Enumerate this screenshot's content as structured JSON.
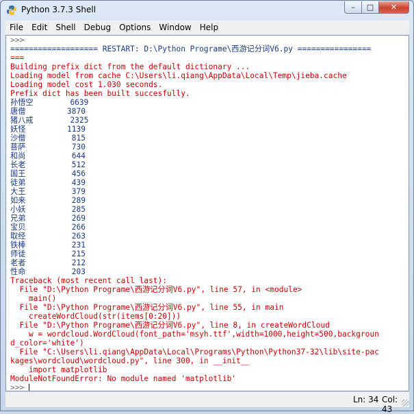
{
  "window": {
    "title": "Python 3.7.3 Shell",
    "buttons": {
      "minimize": "–",
      "maximize": "□",
      "close": "✕"
    }
  },
  "menu": [
    "File",
    "Edit",
    "Shell",
    "Debug",
    "Options",
    "Window",
    "Help"
  ],
  "shell_lines": [
    {
      "text": ">>>",
      "style": "prompt"
    },
    {
      "text": "=================== RESTART: D:\\Python Programe\\西游记分词V6.py ================",
      "style": "out"
    },
    {
      "text": "===",
      "style": "err"
    },
    {
      "text": "Building prefix dict from the default dictionary ...",
      "style": "err"
    },
    {
      "text": "Loading model from cache C:\\Users\\li.qiang\\AppData\\Local\\Temp\\jieba.cache",
      "style": "err"
    },
    {
      "text": "Loading model cost 1.030 seconds.",
      "style": "err"
    },
    {
      "text": "Prefix dict has been built succesfully.",
      "style": "err"
    },
    {
      "text": "孙悟空        6639",
      "style": "out"
    },
    {
      "text": "唐僧         3870",
      "style": "out"
    },
    {
      "text": "猪八戒        2325",
      "style": "out"
    },
    {
      "text": "妖怪         1139",
      "style": "out"
    },
    {
      "text": "沙僧          815",
      "style": "out"
    },
    {
      "text": "菩萨          730",
      "style": "out"
    },
    {
      "text": "和尚          644",
      "style": "out"
    },
    {
      "text": "长老          512",
      "style": "out"
    },
    {
      "text": "国王          456",
      "style": "out"
    },
    {
      "text": "徒弟          439",
      "style": "out"
    },
    {
      "text": "大王          379",
      "style": "out"
    },
    {
      "text": "如来          289",
      "style": "out"
    },
    {
      "text": "小妖          285",
      "style": "out"
    },
    {
      "text": "兄弟          269",
      "style": "out"
    },
    {
      "text": "宝贝          266",
      "style": "out"
    },
    {
      "text": "取经          263",
      "style": "out"
    },
    {
      "text": "铁棒          231",
      "style": "out"
    },
    {
      "text": "师徒          215",
      "style": "out"
    },
    {
      "text": "老者          212",
      "style": "out"
    },
    {
      "text": "性命          203",
      "style": "out"
    },
    {
      "text": "Traceback (most recent call last):",
      "style": "err"
    },
    {
      "text": "  File \"D:\\Python Programe\\西游记分词V6.py\", line 57, in <module>",
      "style": "err"
    },
    {
      "text": "    main()",
      "style": "err"
    },
    {
      "text": "  File \"D:\\Python Programe\\西游记分词V6.py\", line 55, in main",
      "style": "err"
    },
    {
      "text": "    createWordCloud(str(items[0:20]))",
      "style": "err"
    },
    {
      "text": "  File \"D:\\Python Programe\\西游记分词V6.py\", line 8, in createWordCloud",
      "style": "err"
    },
    {
      "text": "    w = wordcloud.WordCloud(font_path='msyh.ttf',width=1000,height=500,backgroun",
      "style": "err"
    },
    {
      "text": "d_color='white')",
      "style": "err"
    },
    {
      "text": "  File \"C:\\Users\\li.qiang\\AppData\\Local\\Programs\\Python\\Python37-32\\lib\\site-pac",
      "style": "err"
    },
    {
      "text": "kages\\wordcloud\\wordcloud.py\", line 300, in __init__",
      "style": "err"
    },
    {
      "text": "    import matplotlib",
      "style": "err"
    },
    {
      "text": "ModuleNotFoundError: No module named 'matplotlib'",
      "style": "err"
    },
    {
      "text": ">>>",
      "style": "prompt"
    }
  ],
  "status": {
    "line": "Ln: 34",
    "col": "Col: 43"
  },
  "colors": {
    "output": "#1a3a8a",
    "error": "#d10000",
    "prompt": "#6a6a6a"
  }
}
